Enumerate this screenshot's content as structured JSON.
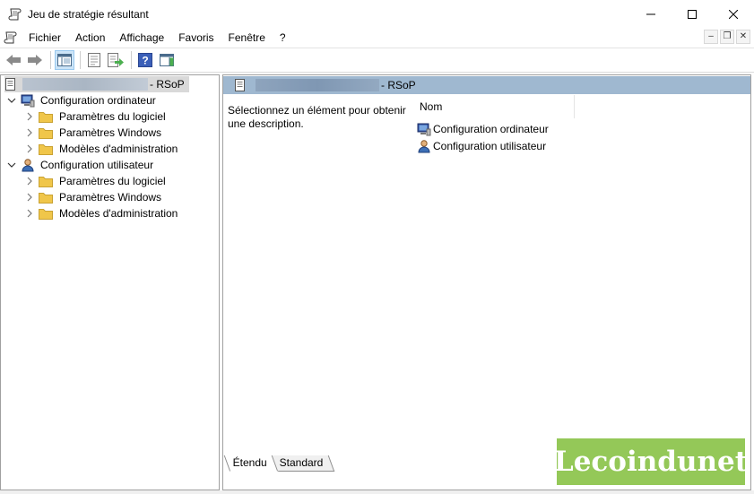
{
  "window": {
    "title": "Jeu de stratégie résultant",
    "minimize": "—",
    "maximize": "☐",
    "close": "✕"
  },
  "menu": {
    "items": [
      "Fichier",
      "Action",
      "Affichage",
      "Favoris",
      "Fenêtre",
      "?"
    ]
  },
  "mdi": {
    "minimize": "–",
    "restore": "❐",
    "close": "✕"
  },
  "toolbar": {
    "buttons": [
      "back-icon",
      "forward-icon",
      "show-hide-tree-icon",
      "properties-icon",
      "export-list-icon",
      "help-icon",
      "show-hide-action-pane-icon"
    ]
  },
  "tree": {
    "root_suffix": "- RSoP",
    "computer": {
      "label": "Configuration ordinateur",
      "children": [
        "Paramètres du logiciel",
        "Paramètres Windows",
        "Modèles d'administration"
      ]
    },
    "user": {
      "label": "Configuration utilisateur",
      "children": [
        "Paramètres du logiciel",
        "Paramètres Windows",
        "Modèles d'administration"
      ]
    }
  },
  "details": {
    "header_suffix": "- RSoP",
    "description": "Sélectionnez un élément pour obtenir une description.",
    "column_name": "Nom",
    "items": [
      "Configuration ordinateur",
      "Configuration utilisateur"
    ]
  },
  "tabs": [
    "Étendu",
    "Standard"
  ],
  "watermark": "Lecoindunet",
  "colors": {
    "header_bar": "#9fb8d0",
    "folder": "#f0c64a",
    "watermark": "#8bc44a",
    "selection": "#d9d9d9"
  }
}
